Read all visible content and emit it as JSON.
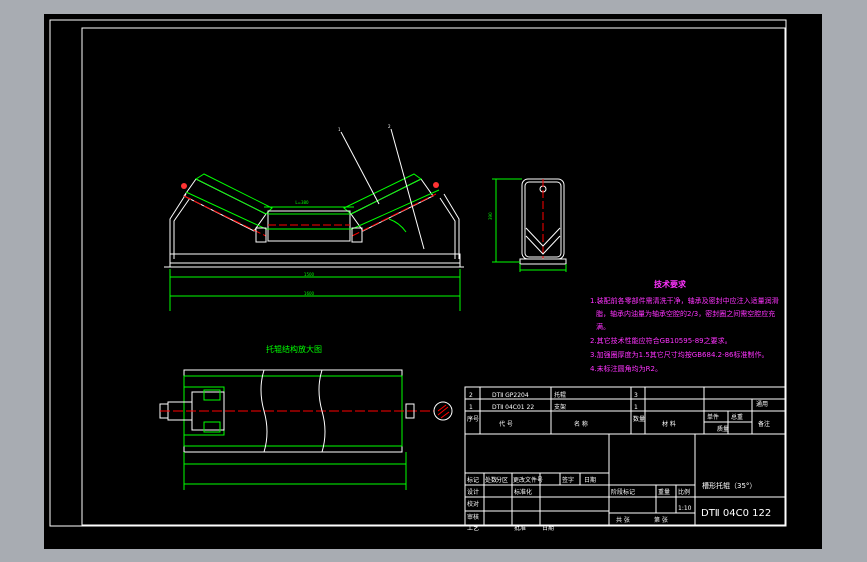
{
  "drawing": {
    "balloon_1": "1",
    "balloon_2": "2",
    "dim_overall_width": "1600",
    "dim_frame_span": "1500",
    "dim_roller_length": "L=380",
    "dim_height": "390",
    "detail_title": "托辊结构放大图"
  },
  "tech_req": {
    "title": "技术要求",
    "lines": [
      "1.装配前各零部件需清洗干净，轴承及密封中应注入适量润滑",
      "脂，轴承内油量为轴承空腔的2/3，密封圈之间需空腔应充",
      "满。",
      "2.其它技术性能应符合GB10595-89之要求。",
      "3.加强圈厚度为1.5其它尺寸均按GB684.2-86标准制作。",
      "4.未标注圆角均为R2。"
    ]
  },
  "parts": {
    "rows": [
      {
        "seq": "2",
        "code": "DTⅡ GP2204",
        "name": "托辊",
        "qty": "3",
        "material": "",
        "note": "通用"
      },
      {
        "seq": "1",
        "code": "DTⅡ 04C01 22",
        "name": "支架",
        "qty": "1",
        "material": "",
        "note": ""
      }
    ],
    "header": {
      "seq": "序号",
      "code": "代  号",
      "name": "名  称",
      "qty": "数量",
      "material": "材  料",
      "unit": "单件",
      "total": "总重",
      "mass": "质量",
      "note": "备注"
    }
  },
  "titleblock": {
    "mark": "标记",
    "count": "处数",
    "zone": "分区",
    "change_doc": "更改文件号",
    "sign": "签字",
    "date": "日期",
    "design": "设计",
    "std": "标准化",
    "check": "校对",
    "review": "审核",
    "process": "工艺",
    "approve": "批准",
    "date2": "日期",
    "stage": "阶段标记",
    "weight": "重量",
    "scale": "比例",
    "scale_val": "1:10",
    "sheets_total": "共  张",
    "sheet_no": "第  张",
    "drawing_name": "槽形托辊（35°）",
    "drawing_no": "DTⅡ 04C0 122"
  }
}
